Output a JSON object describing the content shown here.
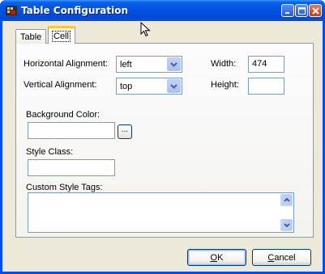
{
  "window": {
    "title": "Table Configuration",
    "controls": {
      "minimize": "_",
      "maximize": "□",
      "close": "✕"
    }
  },
  "tabs": [
    {
      "label": "Table",
      "active": false
    },
    {
      "label": "Cell",
      "active": true
    }
  ],
  "cell": {
    "horizontal_alignment": {
      "label": "Horizontal Alignment:",
      "value": "left"
    },
    "vertical_alignment": {
      "label": "Vertical Alignment:",
      "value": "top"
    },
    "width": {
      "label": "Width:",
      "value": "474"
    },
    "height": {
      "label": "Height:",
      "value": ""
    },
    "background_color": {
      "label": "Background Color:",
      "value": "",
      "browse_label": "..."
    },
    "style_class": {
      "label": "Style Class:",
      "value": ""
    },
    "custom_style_tags": {
      "label": "Custom Style Tags:",
      "value": ""
    }
  },
  "buttons": {
    "ok": {
      "mnemonic": "O",
      "rest": "K"
    },
    "cancel": {
      "mnemonic": "C",
      "rest": "ancel"
    }
  },
  "colors": {
    "titlebar": "#0453e0",
    "client_bg": "#ece9d8",
    "field_border": "#7f9db9",
    "active_tab_accent": "#ffc83c"
  },
  "icons": {
    "app": "table-config-app-icon",
    "dropdown": "chevron-down-icon",
    "scroll_up": "scroll-up-icon",
    "scroll_down": "scroll-down-icon",
    "cursor": "mouse-pointer-icon"
  }
}
